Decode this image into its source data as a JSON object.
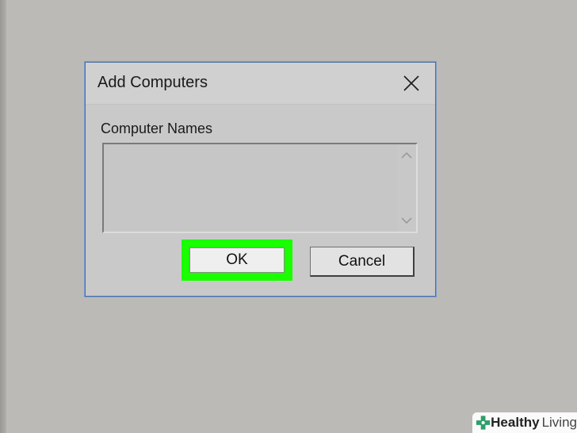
{
  "dialog": {
    "title": "Add Computers",
    "field_label": "Computer Names",
    "names_value": "",
    "ok_label": "OK",
    "cancel_label": "Cancel"
  },
  "icons": {
    "close": "close-icon",
    "scroll_up": "chevron-up-icon",
    "scroll_down": "chevron-down-icon",
    "watermark_logo": "healthy-living-cross-icon"
  },
  "highlight": {
    "target": "ok-button",
    "color": "#1aff00"
  },
  "colors": {
    "desktop": "#bcbab7",
    "dialog_background": "#c9c9c9",
    "dialog_border": "#4a6fa5"
  },
  "watermark": {
    "brand_a": "Healthy",
    "brand_b": "Living",
    "logo_color": "#2e9e6b"
  }
}
